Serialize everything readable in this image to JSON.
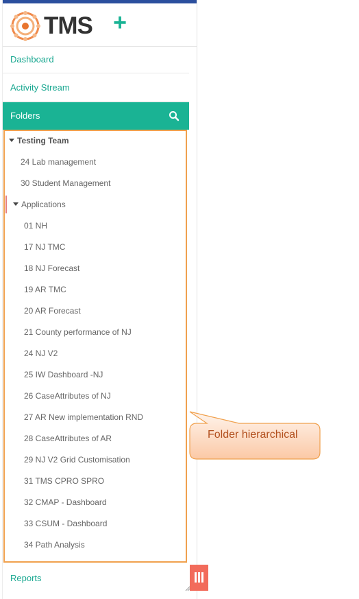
{
  "brand": {
    "name": "TMS",
    "add_label": "+"
  },
  "nav": {
    "dashboard": "Dashboard",
    "activity_stream": "Activity Stream",
    "folders": "Folders",
    "reports": "Reports"
  },
  "tree": {
    "root": "Testing Team",
    "items": [
      "24 Lab management",
      "30 Student Management"
    ],
    "group": "Applications",
    "children": [
      "01 NH",
      "17 NJ TMC",
      "18 NJ Forecast",
      "19 AR TMC",
      "20 AR Forecast",
      "21 County performance of NJ",
      "24 NJ V2",
      "25 IW Dashboard -NJ",
      "26 CaseAttributes of NJ",
      "27 AR New implementation RND",
      "28 CaseAttributes of AR",
      "29 NJ V2 Grid Customisation",
      "31 TMS CPRO SPRO",
      "32 CMAP - Dashboard",
      "33 CSUM - Dashboard",
      "34 Path Analysis"
    ]
  },
  "annotation": {
    "text": "Folder hierarchical"
  },
  "colors": {
    "accent": "#1ab394",
    "highlight": "#f0a14e",
    "collapse": "#f26b5b",
    "topbar": "#2b4f9e"
  }
}
